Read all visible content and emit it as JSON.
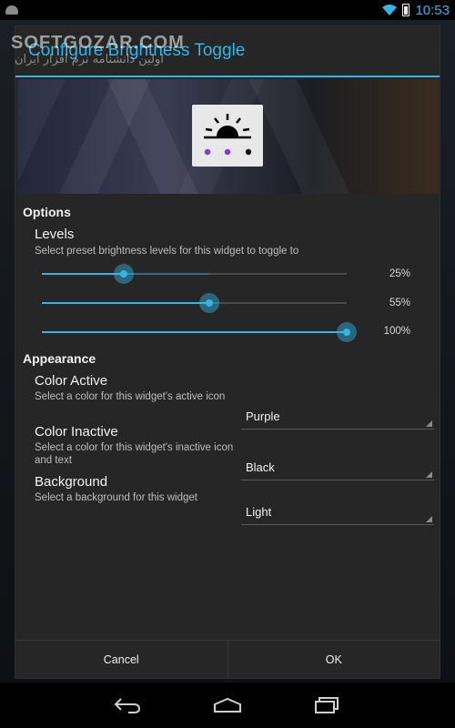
{
  "status_bar": {
    "time": "10:53",
    "icons": [
      "android-notification-icon",
      "wifi-icon",
      "battery-icon"
    ]
  },
  "watermark": {
    "brand": "SOFTGOZAR.COM",
    "subtitle": "اولین دانشنامه نرم افزار ایران"
  },
  "dialog": {
    "title": "Configure Brightness Toggle",
    "preview": {
      "icon": "sun-brightness-icon",
      "dot_colors": [
        "#7c3aed",
        "#7c3aed",
        "#000000"
      ]
    },
    "options": {
      "heading": "Options",
      "levels": {
        "title": "Levels",
        "summary": "Select preset brightness levels for this widget to toggle to",
        "sliders": [
          {
            "value_label": "25%",
            "fill_fraction": 0.27
          },
          {
            "value_label": "55%",
            "fill_fraction": 0.55
          },
          {
            "value_label": "100%",
            "fill_fraction": 1.0
          }
        ]
      }
    },
    "appearance": {
      "heading": "Appearance",
      "color_active": {
        "title": "Color Active",
        "summary": "Select a color for this widget's active icon",
        "value": "Purple"
      },
      "color_inactive": {
        "title": "Color Inactive",
        "summary": "Select a color for this widget's inactive icon and text",
        "value": "Black"
      },
      "background": {
        "title": "Background",
        "summary": "Select a background for this widget",
        "value": "Light"
      }
    },
    "buttons": {
      "cancel": "Cancel",
      "ok": "OK"
    }
  },
  "nav_bar": {
    "icons": [
      "back-icon",
      "home-icon",
      "recents-icon"
    ]
  },
  "colors": {
    "accent": "#33b5e5",
    "dialog_bg": "#262626"
  }
}
